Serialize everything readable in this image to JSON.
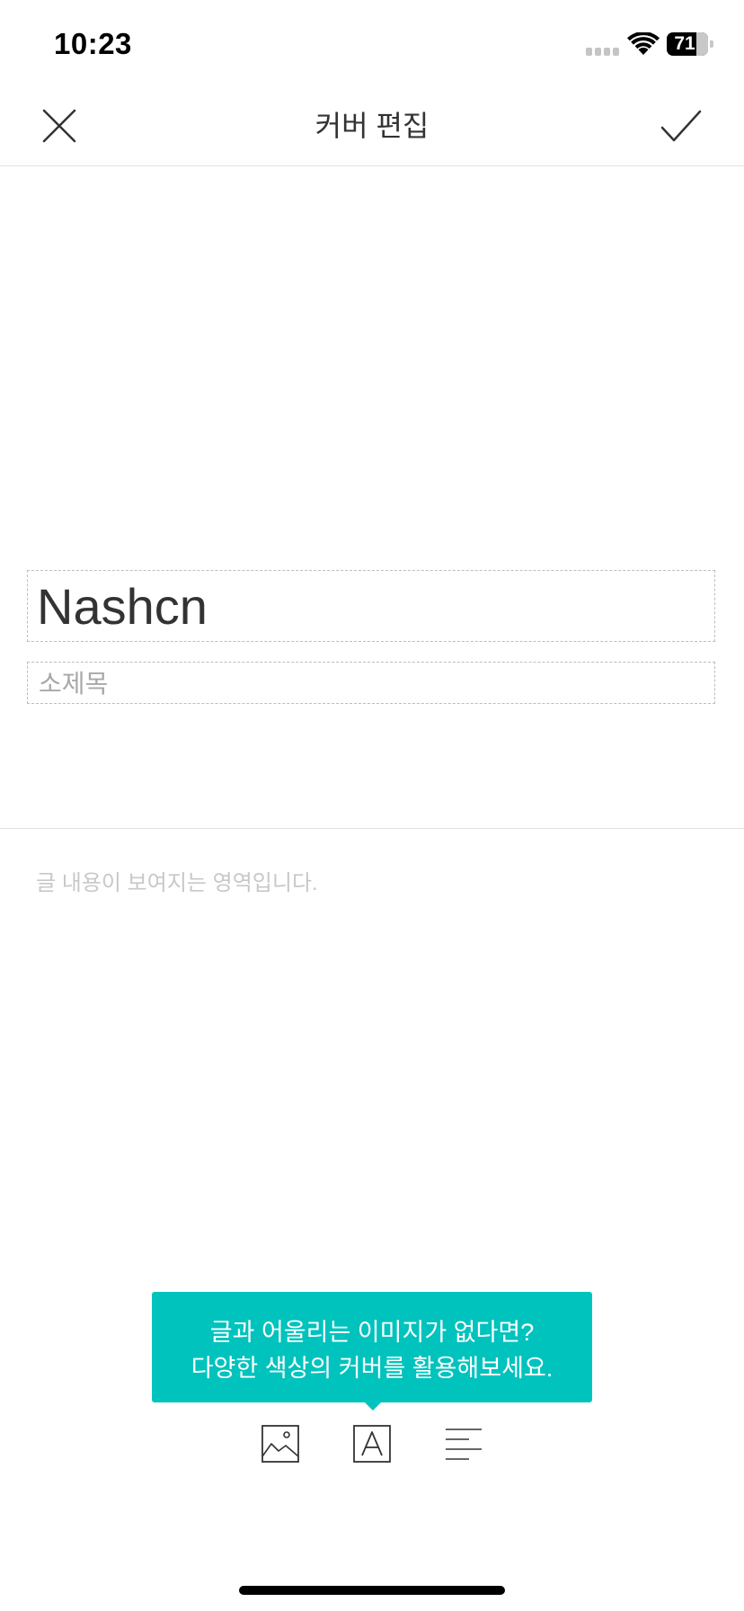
{
  "status_bar": {
    "time": "10:23",
    "battery_percent": "71",
    "battery_level": 0.71
  },
  "nav": {
    "title": "커버 편집",
    "close_icon": "close-icon",
    "confirm_icon": "checkmark-icon"
  },
  "cover": {
    "title": "Nashcn",
    "subtitle_placeholder": "소제목",
    "body_placeholder": "글 내용이 보여지는 영역입니다."
  },
  "tooltip": {
    "line1": "글과 어울리는 이미지가 없다면?",
    "line2": "다양한 색상의 커버를 활용해보세요.",
    "color": "#00c3bd"
  },
  "toolbar": {
    "items": [
      {
        "icon": "image-icon"
      },
      {
        "icon": "text-style-icon"
      },
      {
        "icon": "align-left-icon"
      }
    ]
  }
}
